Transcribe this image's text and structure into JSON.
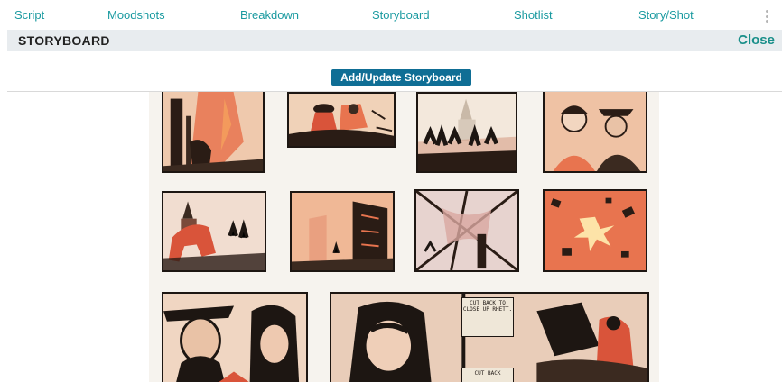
{
  "nav": {
    "tabs": [
      "Script",
      "Moodshots",
      "Breakdown",
      "Storyboard",
      "Shotlist",
      "Story/Shot"
    ],
    "more_icon": "vertical-ellipsis-icon"
  },
  "header": {
    "title": "STORYBOARD",
    "close_label": "Close"
  },
  "toolbar": {
    "update_label": "Add/Update Storyboard"
  },
  "storyboard": {
    "notes": [
      "CUT BACK TO CLOSE UP RHETT.",
      "CUT BACK"
    ]
  },
  "colors": {
    "accent": "#1a9aa0",
    "button": "#0f6e95",
    "titlebar": "#e8ecef",
    "ink": "#1d1612",
    "wash": "#e8744f"
  }
}
